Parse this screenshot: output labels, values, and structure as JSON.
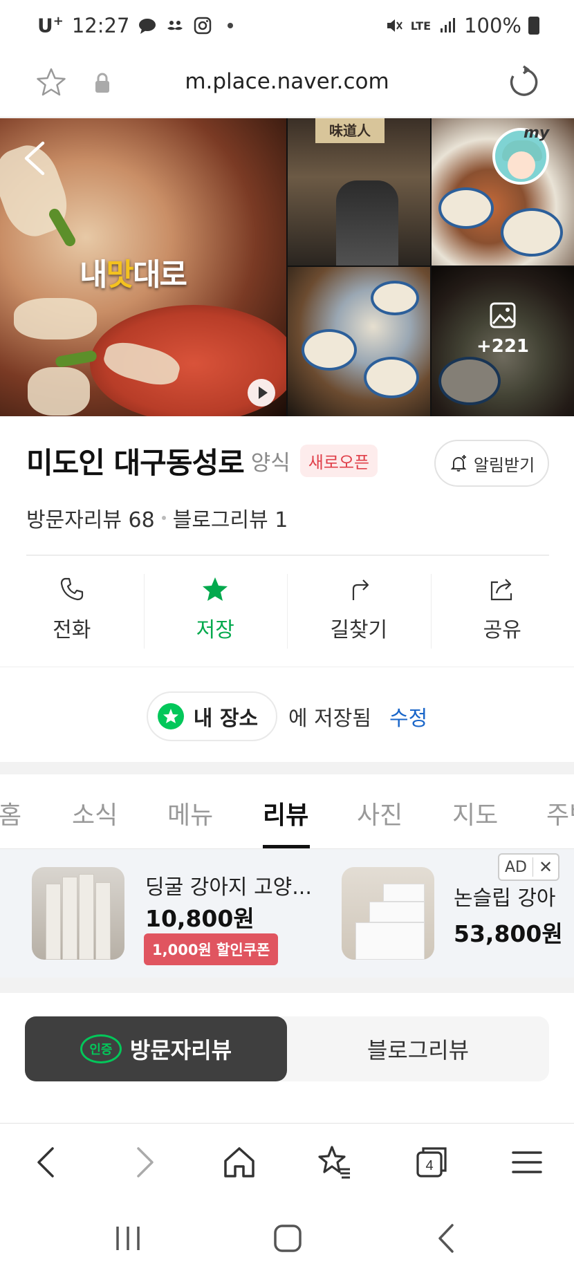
{
  "status_bar": {
    "carrier": "U",
    "carrier_sup": "+",
    "time": "12:27",
    "network": "LTE",
    "battery": "100%"
  },
  "url_bar": {
    "url": "m.place.naver.com"
  },
  "photos": {
    "video_caption_a": "내",
    "video_caption_b": "맛",
    "video_caption_c": "대로",
    "sign_text": "味道人",
    "avatar_tag": "my",
    "more_count": "+221"
  },
  "place": {
    "name": "미도인 대구동성로",
    "category": "양식",
    "badge": "새로오픈",
    "alarm_label": "알림받기",
    "visitor_reviews": "방문자리뷰 68",
    "blog_reviews": "블로그리뷰 1"
  },
  "actions": [
    {
      "label": "전화",
      "icon": "phone-icon"
    },
    {
      "label": "저장",
      "icon": "star-icon"
    },
    {
      "label": "길찾기",
      "icon": "directions-icon"
    },
    {
      "label": "공유",
      "icon": "share-icon"
    }
  ],
  "saved": {
    "chip_label": "내 장소",
    "text": "에 저장됨",
    "edit": "수정"
  },
  "tabs": [
    "홈",
    "소식",
    "메뉴",
    "리뷰",
    "사진",
    "지도",
    "주변"
  ],
  "active_tab": "리뷰",
  "ad": {
    "tag": "AD",
    "close": "✕",
    "item1": {
      "title": "딩굴 강아지 고양...",
      "price": "10,800원",
      "coupon": "1,000원 할인쿠폰"
    },
    "item2": {
      "title": "논슬립 강아",
      "price": "53,800원"
    }
  },
  "review_toggle": {
    "cert_label": "인증",
    "visitor": "방문자리뷰",
    "blog": "블로그리뷰"
  },
  "browser_toolbar": {
    "tab_count": "4"
  },
  "colors": {
    "naver_green": "#03c75a",
    "saved_green": "#03a94d",
    "badge_red": "#e0404a",
    "link_blue": "#1a66c9"
  }
}
